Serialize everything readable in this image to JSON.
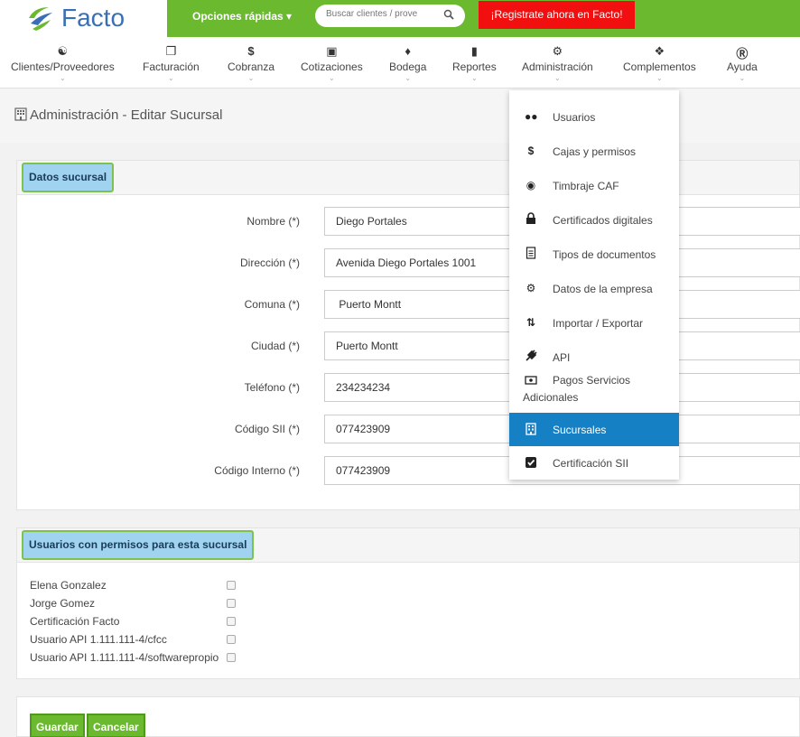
{
  "header": {
    "logo_text": "Facto",
    "quick_options": "Opciones rápidas ▾",
    "search_placeholder": "Buscar clientes / prove",
    "register_label": "¡Registrate ahora en Facto!"
  },
  "nav": {
    "items": [
      {
        "label": "Clientes/Proveedores",
        "icon": "users-icon"
      },
      {
        "label": "Facturación",
        "icon": "documents-icon"
      },
      {
        "label": "Cobranza",
        "icon": "dollar-icon"
      },
      {
        "label": "Cotizaciones",
        "icon": "cart-icon"
      },
      {
        "label": "Bodega",
        "icon": "cubes-icon"
      },
      {
        "label": "Reportes",
        "icon": "bar-chart-icon"
      },
      {
        "label": "Administración",
        "icon": "cogs-icon"
      },
      {
        "label": "Complementos",
        "icon": "puzzle-icon"
      },
      {
        "label": "Ayuda",
        "icon": "help-icon"
      }
    ]
  },
  "page": {
    "title": "Administración - Editar Sucursal"
  },
  "sucursal": {
    "section_title": "Datos sucursal",
    "fields": [
      {
        "label": "Nombre (*)",
        "value": "Diego Portales"
      },
      {
        "label": "Dirección (*)",
        "value": "Avenida Diego Portales 1001"
      },
      {
        "label": "Comuna (*)",
        "value": " Puerto Montt"
      },
      {
        "label": "Ciudad (*)",
        "value": "Puerto Montt"
      },
      {
        "label": "Teléfono (*)",
        "value": "234234234"
      },
      {
        "label": "Código SII (*)",
        "value": "077423909"
      },
      {
        "label": "Código Interno (*)",
        "value": "077423909"
      }
    ]
  },
  "users": {
    "section_title": "Usuarios con permisos para esta sucursal",
    "list": [
      {
        "name": "Elena Gonzalez",
        "checked": false
      },
      {
        "name": "Jorge Gomez",
        "checked": false
      },
      {
        "name": "Certificación Facto",
        "checked": false
      },
      {
        "name": "Usuario API 1.111.111-4/cfcc",
        "checked": false
      },
      {
        "name": "Usuario API 1.111.111-4/softwarepropio",
        "checked": false
      }
    ]
  },
  "actions": {
    "save_label": "Guardar",
    "cancel_label": "Cancelar"
  },
  "admin_menu": {
    "items": [
      {
        "label": "Usuarios",
        "icon": "users-icon"
      },
      {
        "label": "Cajas y permisos",
        "icon": "dollar-icon"
      },
      {
        "label": "Timbraje CAF",
        "icon": "stamp-icon"
      },
      {
        "label": "Certificados digitales",
        "icon": "lock-icon"
      },
      {
        "label": "Tipos de documentos",
        "icon": "document-icon"
      },
      {
        "label": "Datos de la empresa",
        "icon": "gear-icon"
      },
      {
        "label": "Importar / Exportar",
        "icon": "retweet-icon"
      },
      {
        "label": "API",
        "icon": "plug-icon"
      },
      {
        "label": "Pagos Servicios",
        "label2": "Adicionales",
        "icon": "money-icon"
      },
      {
        "label": "Sucursales",
        "icon": "building-icon",
        "active": true
      },
      {
        "label": "Certificación SII",
        "icon": "check-square-icon"
      }
    ]
  },
  "colors": {
    "brand_green": "#6ab92f",
    "register_red": "#f20f0f",
    "active_blue": "#1680c5",
    "section_tag_blue": "#9fd3f0"
  }
}
